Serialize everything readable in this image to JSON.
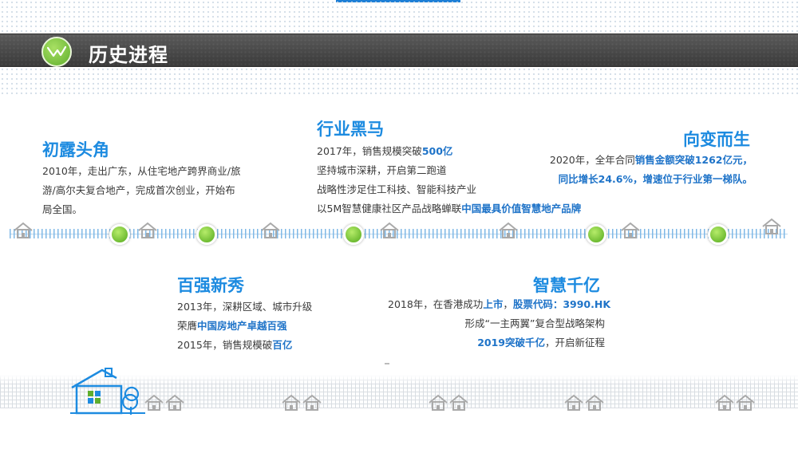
{
  "header": {
    "title": "历史进程"
  },
  "milestones": [
    {
      "id": "m2010",
      "heading": "初露头角",
      "lines": [
        [
          {
            "t": "2010年，走出广东，从住宅地产跨界商业/旅"
          }
        ],
        [
          {
            "t": "游/高尔夫复合地产，完成首次创业，开始布"
          }
        ],
        [
          {
            "t": "局全国。"
          }
        ]
      ]
    },
    {
      "id": "m2013",
      "heading": "百强新秀",
      "lines": [
        [
          {
            "t": "2013年，深耕区域、城市升级"
          }
        ],
        [
          {
            "t": "荣膺"
          },
          {
            "t": "中国房地产卓越百强",
            "hl": true
          }
        ],
        [
          {
            "t": "2015年，销售规模破"
          },
          {
            "t": "百亿",
            "hl": true
          }
        ]
      ]
    },
    {
      "id": "m2017",
      "heading": "行业黑马",
      "lines": [
        [
          {
            "t": "2017年，销售规模突破"
          },
          {
            "t": "500亿",
            "hl": true
          }
        ],
        [
          {
            "t": "坚持城市深耕，开启第二跑道"
          }
        ],
        [
          {
            "t": "战略性涉足住工科技、智能科技产业"
          }
        ],
        [
          {
            "t": "以5M智慧健康社区产品战略蝉联"
          },
          {
            "t": "中国最具价值智慧地产品牌",
            "hl": true
          }
        ]
      ]
    },
    {
      "id": "m2018",
      "heading": "智慧千亿",
      "lines": [
        [
          {
            "t": "2018年，在香港成功"
          },
          {
            "t": "上市",
            "hl": true
          },
          {
            "t": "，"
          },
          {
            "t": "股票代码：3990.HK",
            "hl": true
          }
        ],
        [
          {
            "t": "形成“一主两翼”复合型战略架构"
          }
        ],
        [
          {
            "t": "2019突破千亿",
            "hl": true
          },
          {
            "t": "，开启新征程"
          }
        ]
      ]
    },
    {
      "id": "m2020",
      "heading": "向变而生",
      "lines": [
        [
          {
            "t": "2020年，全年合同"
          },
          {
            "t": "销售金额突破1262亿元，",
            "hl": true
          }
        ],
        [
          {
            "t": "同比增长24.6%，增速位于行业第一梯队。",
            "hl": true
          }
        ]
      ]
    }
  ],
  "timeline": {
    "node_count": 6
  },
  "colors": {
    "heading": "#1d8be0",
    "highlight": "#1e73c8",
    "node_green": "#52a81c",
    "title_bar": "#3a3a3a"
  },
  "icons": [
    "logo-check-icon",
    "house-icon",
    "tree-icon"
  ]
}
